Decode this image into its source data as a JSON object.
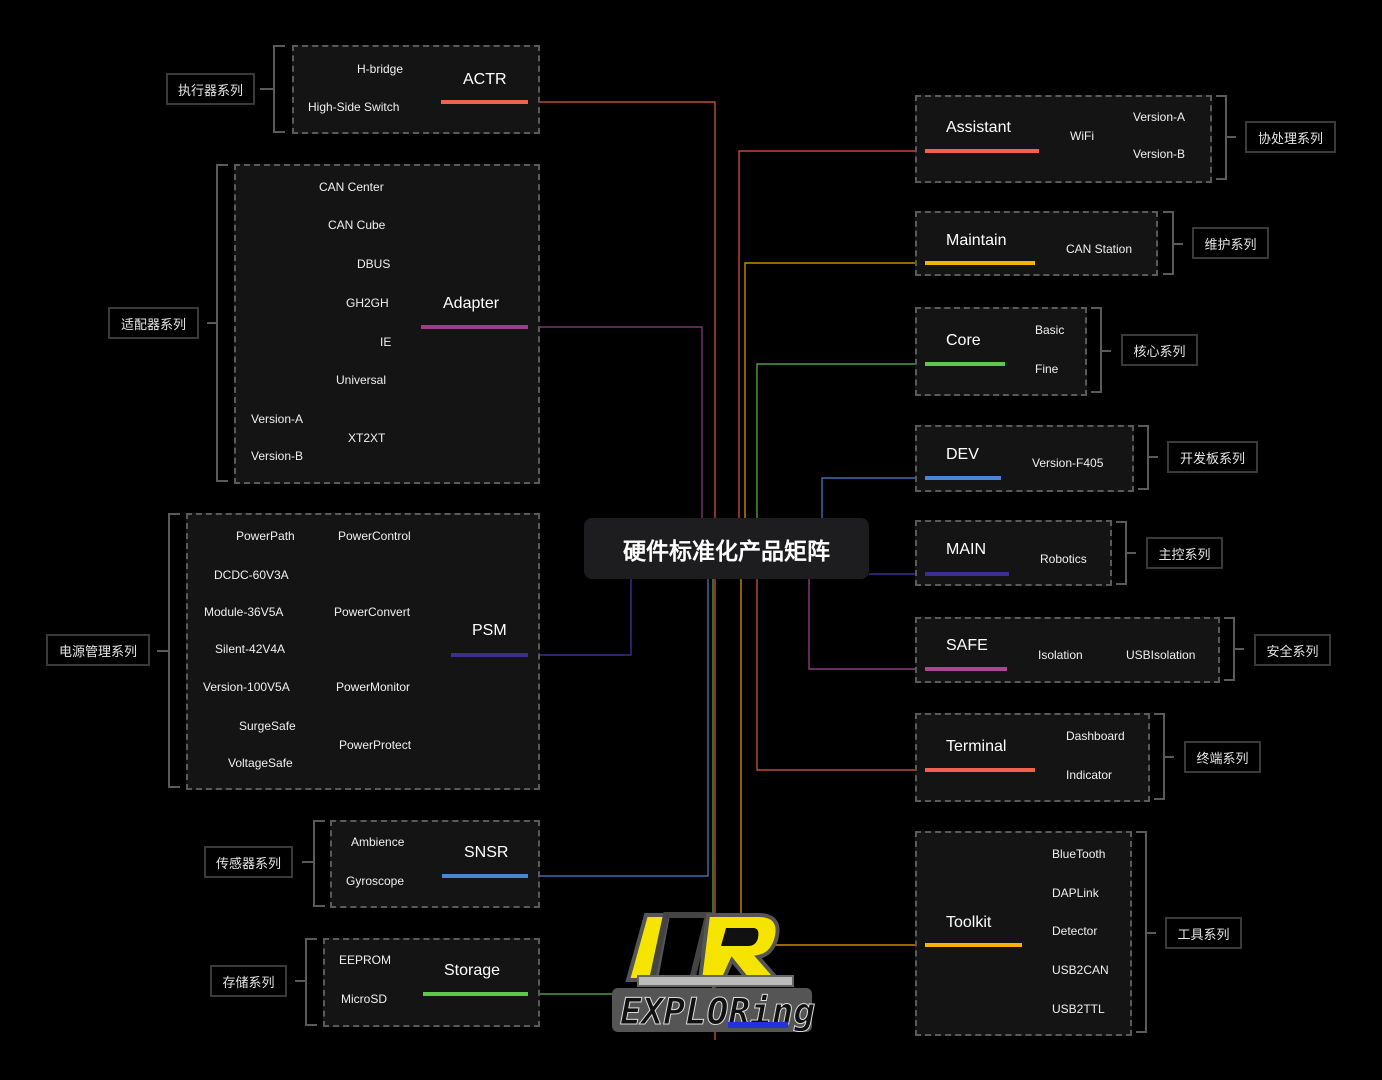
{
  "center": {
    "title": "硬件标准化产品矩阵"
  },
  "colors": {
    "actr": "#f0614f",
    "adapter": "#9c3c8c",
    "psm": "#3b2f91",
    "snsr": "#4a86d6",
    "storage": "#5dc94a",
    "assistant": "#f0614f",
    "maintain": "#f5b400",
    "core": "#5dc94a",
    "dev": "#4a86d6",
    "main": "#3b2f91",
    "safe": "#a8488f",
    "terminal": "#f0614f",
    "toolkit": "#f5b400"
  },
  "left": {
    "actr": {
      "category": "执行器系列",
      "title": "ACTR",
      "items": [
        "H-bridge",
        "High-Side Switch"
      ]
    },
    "adapter": {
      "category": "适配器系列",
      "title": "Adapter",
      "items": [
        "CAN Center",
        "CAN Cube",
        "DBUS",
        "GH2GH",
        "IE",
        "Universal",
        "XT2XT"
      ],
      "xt2xt_items": [
        "Version-A",
        "Version-B"
      ]
    },
    "psm": {
      "category": "电源管理系列",
      "title": "PSM",
      "groups": [
        {
          "label": "PowerControl",
          "items": [
            "PowerPath"
          ]
        },
        {
          "label": "PowerConvert",
          "items": [
            "DCDC-60V3A",
            "Module-36V5A",
            "Silent-42V4A"
          ]
        },
        {
          "label": "PowerMonitor",
          "items": [
            "Version-100V5A"
          ]
        },
        {
          "label": "PowerProtect",
          "items": [
            "SurgeSafe",
            "VoltageSafe"
          ]
        }
      ]
    },
    "snsr": {
      "category": "传感器系列",
      "title": "SNSR",
      "items": [
        "Ambience",
        "Gyroscope"
      ]
    },
    "storage": {
      "category": "存储系列",
      "title": "Storage",
      "items": [
        "EEPROM",
        "MicroSD"
      ]
    }
  },
  "right": {
    "assistant": {
      "category": "协处理系列",
      "title": "Assistant",
      "sub": "WiFi",
      "items": [
        "Version-A",
        "Version-B"
      ]
    },
    "maintain": {
      "category": "维护系列",
      "title": "Maintain",
      "items": [
        "CAN Station"
      ]
    },
    "core": {
      "category": "核心系列",
      "title": "Core",
      "items": [
        "Basic",
        "Fine"
      ]
    },
    "dev": {
      "category": "开发板系列",
      "title": "DEV",
      "items": [
        "Version-F405"
      ]
    },
    "main": {
      "category": "主控系列",
      "title": "MAIN",
      "items": [
        "Robotics"
      ]
    },
    "safe": {
      "category": "安全系列",
      "title": "SAFE",
      "items": [
        "Isolation",
        "USBIsolation"
      ]
    },
    "terminal": {
      "category": "终端系列",
      "title": "Terminal",
      "items": [
        "Dashboard",
        "Indicator"
      ]
    },
    "toolkit": {
      "category": "工具系列",
      "title": "Toolkit",
      "items": [
        "BlueTooth",
        "DAPLink",
        "Detector",
        "USB2CAN",
        "USB2TTL"
      ]
    }
  },
  "logo": {
    "top": "AR",
    "bottom": "EXPLORing"
  }
}
